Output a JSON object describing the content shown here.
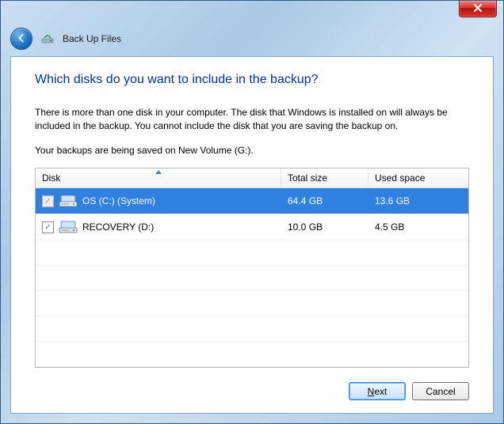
{
  "toolbar": {
    "title": "Back Up Files"
  },
  "heading": "Which disks do you want to include in the backup?",
  "description": "There is more than one disk in your computer. The disk that Windows is installed on will always be included in the backup. You cannot include the disk that you are saving the backup on.",
  "save_location_line": "Your backups are being saved on New Volume (G:).",
  "columns": {
    "disk": "Disk",
    "total": "Total size",
    "used": "Used space"
  },
  "rows": [
    {
      "name": "OS (C:) (System)",
      "total": "64.4 GB",
      "used": "13.6 GB",
      "checked": true,
      "disabled": true,
      "selected": true
    },
    {
      "name": "RECOVERY (D:)",
      "total": "10.0 GB",
      "used": "4.5 GB",
      "checked": true,
      "disabled": false,
      "selected": false
    }
  ],
  "buttons": {
    "next_prefix": "N",
    "next_rest": "ext",
    "cancel": "Cancel"
  }
}
